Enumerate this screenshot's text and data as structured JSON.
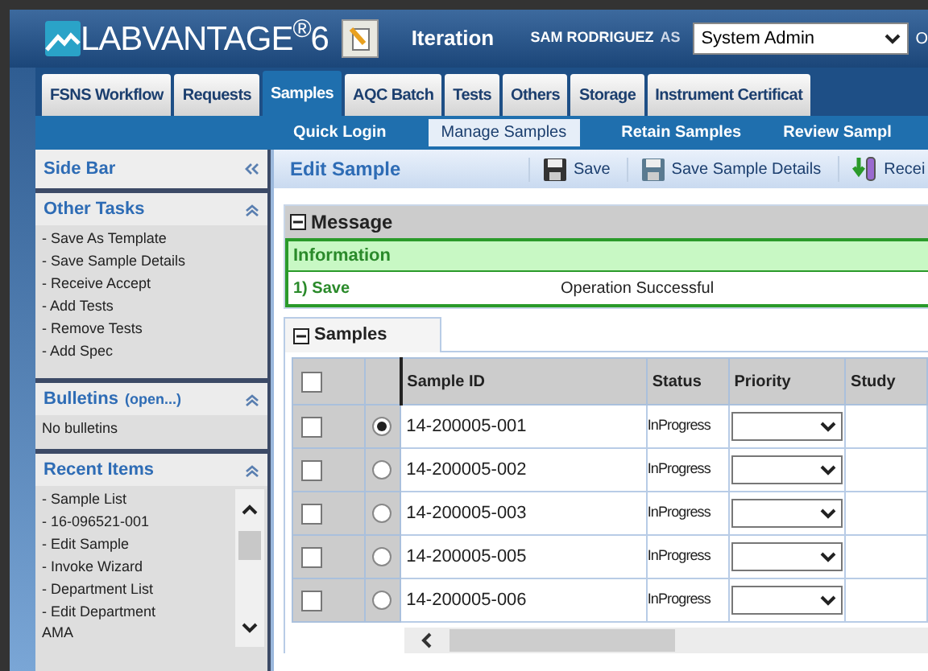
{
  "header": {
    "logo": "LABVANTAGE$^{®}$6",
    "context": "Iteration",
    "user": "SAM RODRIGUEZ",
    "as_label": "AS",
    "role": "System Admin",
    "cut_label": "O"
  },
  "tabs": [
    {
      "label": "FSNS Workflow",
      "selected": false
    },
    {
      "label": "Requests",
      "selected": false
    },
    {
      "label": "Samples",
      "selected": true
    },
    {
      "label": "AQC Batch",
      "selected": false
    },
    {
      "label": "Tests",
      "selected": false
    },
    {
      "label": "Others",
      "selected": false
    },
    {
      "label": "Storage",
      "selected": false
    },
    {
      "label": "Instrument Certificat",
      "selected": false
    }
  ],
  "subnav": [
    {
      "label": "Quick Login",
      "selected": false
    },
    {
      "label": "Manage Samples",
      "selected": true
    },
    {
      "label": "Retain Samples",
      "selected": false
    },
    {
      "label": "Review Sampl",
      "selected": false
    }
  ],
  "sidebar": {
    "title": "Side Bar",
    "sections": [
      {
        "kind": "links",
        "title": "Other Tasks",
        "items": [
          "- Save As Template",
          "- Save Sample Details",
          "- Receive Accept",
          "- Add Tests",
          "- Remove Tests",
          "- Add Spec"
        ]
      },
      {
        "kind": "text",
        "title": "Bulletins",
        "link": "(open...)",
        "items": [
          "No bulletins"
        ]
      },
      {
        "kind": "scroll_links",
        "title": "Recent Items",
        "items": [
          "- Sample List",
          "- 16-096521-001",
          "- Edit Sample",
          "- Invoke Wizard",
          "- Department List",
          "- Edit Department\nAMA"
        ]
      }
    ]
  },
  "toolbar": {
    "title": "Edit Sample",
    "buttons": [
      {
        "kind": "save",
        "label": "Save"
      },
      {
        "kind": "save_details",
        "label": "Save Sample Details"
      },
      {
        "kind": "receive",
        "label": "Recei"
      }
    ]
  },
  "message": {
    "title": "Message",
    "heading": "Information",
    "rows": [
      {
        "label": "1) Save",
        "text": "Operation Successful"
      }
    ]
  },
  "samples": {
    "tab": "Samples",
    "select_all_checked": false,
    "columns": [
      "Sample ID",
      "Status",
      "Priority",
      "Study"
    ],
    "rows": [
      {
        "checked": false,
        "selected": true,
        "sample_id": "14-200005-001",
        "status": "InProgress"
      },
      {
        "checked": false,
        "selected": false,
        "sample_id": "14-200005-002",
        "status": "InProgress"
      },
      {
        "checked": false,
        "selected": false,
        "sample_id": "14-200005-003",
        "status": "InProgress"
      },
      {
        "checked": false,
        "selected": false,
        "sample_id": "14-200005-005",
        "status": "InProgress"
      },
      {
        "checked": false,
        "selected": false,
        "sample_id": "14-200005-006",
        "status": "InProgress"
      }
    ]
  }
}
